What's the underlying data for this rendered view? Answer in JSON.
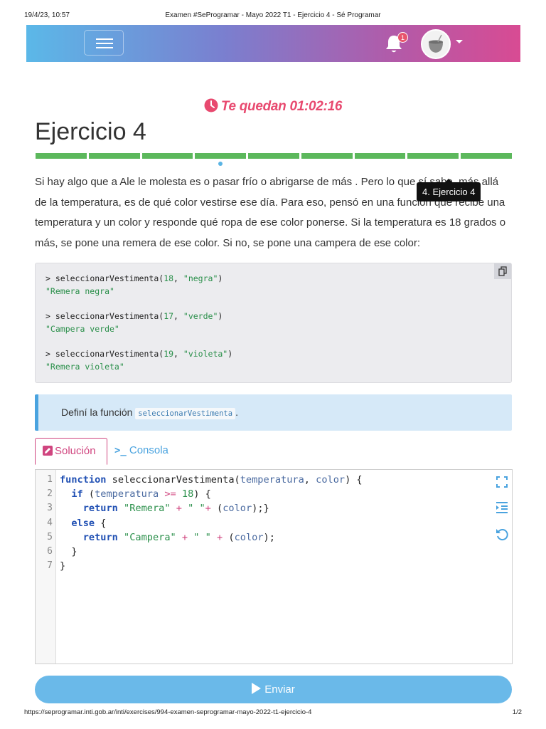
{
  "print_header": {
    "datetime": "19/4/23, 10:57",
    "title": "Examen #SeProgramar - Mayo 2022 T1 - Ejercicio 4 - Sé Programar"
  },
  "navbar": {
    "notification_count": "1",
    "gradient": [
      "#5bb8e8",
      "#7a7fcf",
      "#b35aa8",
      "#d84b93"
    ]
  },
  "timer": {
    "text": "Te quedan 01:02:16",
    "color": "#e8496f"
  },
  "exercise": {
    "title": "Ejercicio 4",
    "progress": {
      "total": 9,
      "current": 4,
      "color": "#5cb85c"
    },
    "tooltip": "4. Ejercicio 4",
    "description": "Si hay algo que a Ale le molesta es o pasar frío o abrigarse de más . Pero lo que sí sabe, más allá de la temperatura, es de qué color vestirse ese día. Para eso, pensó en una función que recibe una temperatura y un color y responde qué ropa de ese color ponerse. Si la temperatura es 18 grados o más, se pone una remera de ese color. Si no, se pone una campera de ese color:"
  },
  "examples": [
    {
      "prompt": "> ",
      "fn": "seleccionarVestimenta(",
      "num": "18",
      "sep": ", ",
      "arg": "\"negra\"",
      "close": ")",
      "result": "\"Remera negra\""
    },
    {
      "prompt": "> ",
      "fn": "seleccionarVestimenta(",
      "num": "17",
      "sep": ", ",
      "arg": "\"verde\"",
      "close": ")",
      "result": "\"Campera verde\""
    },
    {
      "prompt": "> ",
      "fn": "seleccionarVestimenta(",
      "num": "19",
      "sep": ", ",
      "arg": "\"violeta\"",
      "close": ")",
      "result": "\"Remera violeta\""
    }
  ],
  "instruction": {
    "text": "Definí la función",
    "code": "seleccionarVestimenta",
    "suffix": "."
  },
  "tabs": {
    "solution": "Solución",
    "console": "Consola"
  },
  "editor": {
    "line_numbers": [
      "1",
      "2",
      "3",
      "4",
      "5",
      "6",
      "7"
    ],
    "code": [
      "function seleccionarVestimenta(temperatura, color) {",
      "  if (temperatura >= 18) {",
      "    return \"Remera\" + \" \"+ (color);}",
      "  else {",
      "    return \"Campera\" + \" \" + (color);",
      "  }",
      "}"
    ]
  },
  "submit_label": "Enviar",
  "print_footer": {
    "url": "https://seprogramar.inti.gob.ar/inti/exercises/994-examen-seprogramar-mayo-2022-t1-ejercicio-4",
    "page": "1/2"
  },
  "icons": {
    "menu": "hamburger-icon",
    "notifications": "bell-icon",
    "timer": "clock-icon",
    "copy": "copy-icon",
    "solution_tab": "edit-icon",
    "console_tab": "terminal-icon",
    "fullscreen": "expand-icon",
    "indent": "indent-icon",
    "reset": "undo-icon",
    "submit": "play-icon"
  }
}
